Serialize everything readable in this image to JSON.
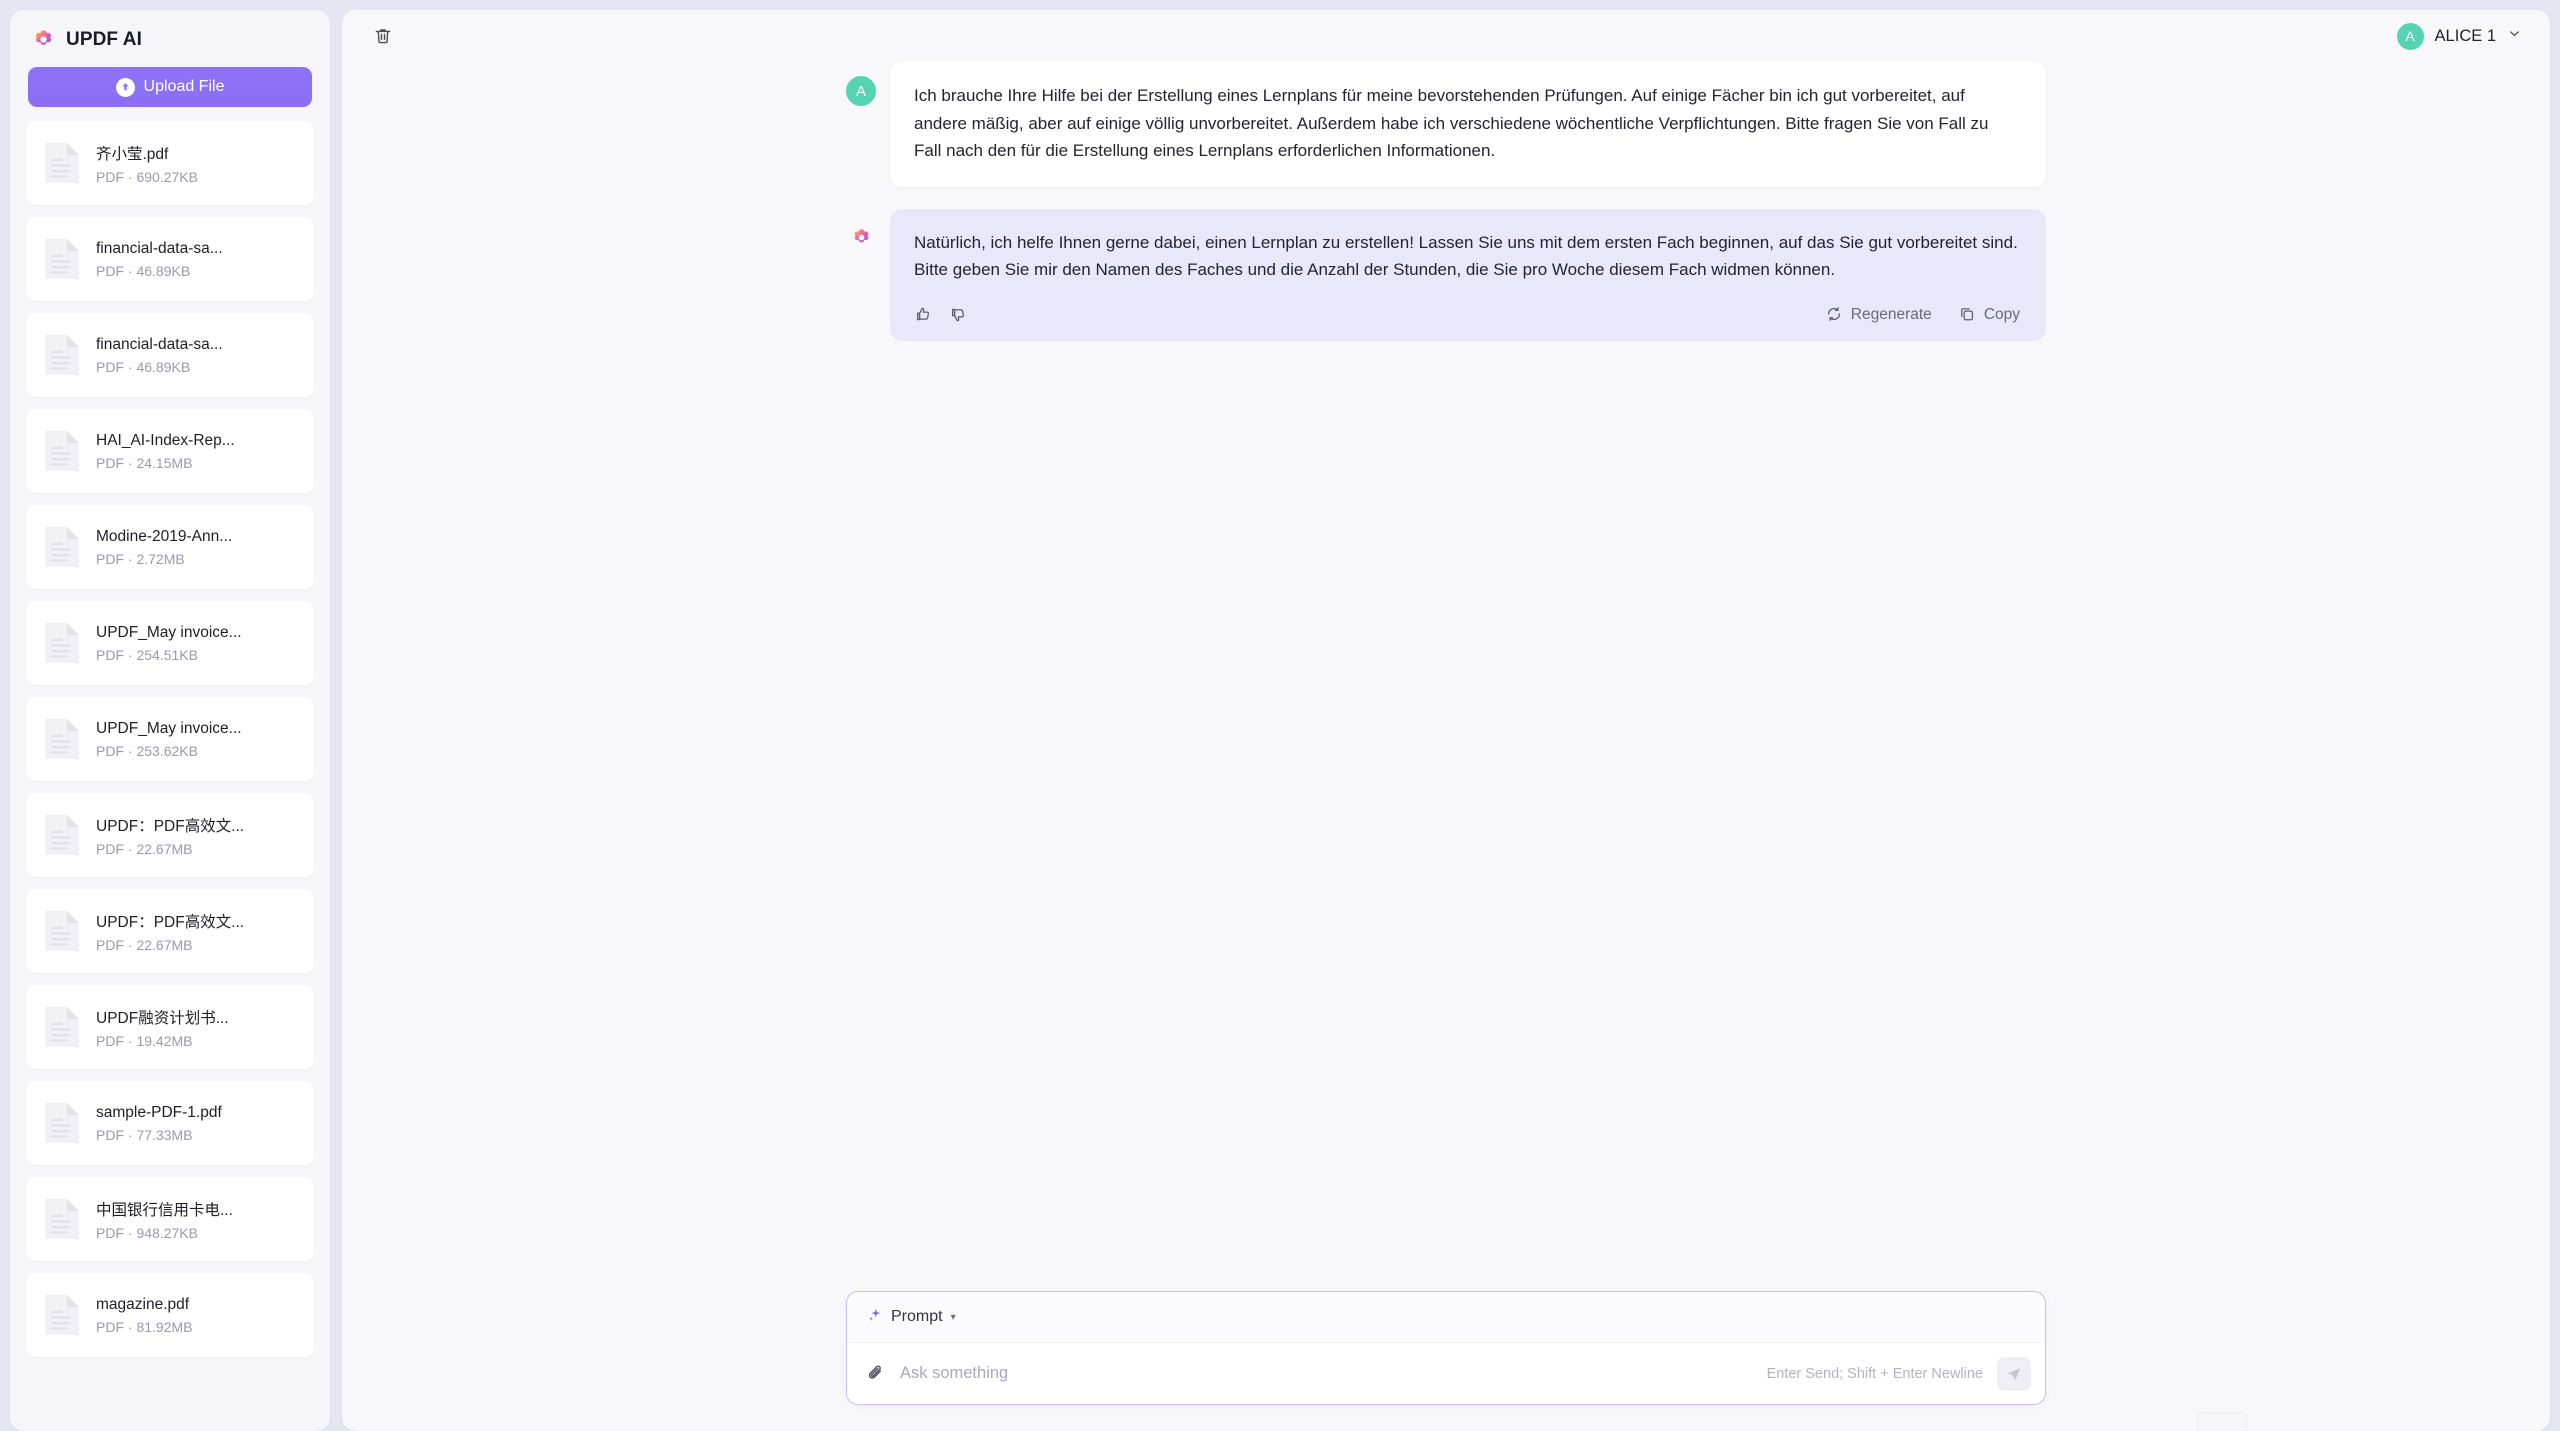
{
  "brand": {
    "title": "UPDF AI",
    "logo_icon": "updf-flower-logo"
  },
  "sidebar": {
    "upload_button": {
      "label": "Upload File",
      "icon": "upload-circle-icon"
    },
    "files": [
      {
        "name": "齐小莹.pdf",
        "meta": "PDF · 690.27KB"
      },
      {
        "name": "financial-data-sa...",
        "meta": "PDF · 46.89KB"
      },
      {
        "name": "financial-data-sa...",
        "meta": "PDF · 46.89KB"
      },
      {
        "name": "HAI_AI-Index-Rep...",
        "meta": "PDF · 24.15MB"
      },
      {
        "name": "Modine-2019-Ann...",
        "meta": "PDF · 2.72MB"
      },
      {
        "name": "UPDF_May invoice...",
        "meta": "PDF · 254.51KB"
      },
      {
        "name": "UPDF_May invoice...",
        "meta": "PDF · 253.62KB"
      },
      {
        "name": "UPDF：PDF高效文...",
        "meta": "PDF · 22.67MB"
      },
      {
        "name": "UPDF：PDF高效文...",
        "meta": "PDF · 22.67MB"
      },
      {
        "name": "UPDF融资计划书...",
        "meta": "PDF · 19.42MB"
      },
      {
        "name": "sample-PDF-1.pdf",
        "meta": "PDF · 77.33MB"
      },
      {
        "name": "中国银行信用卡电...",
        "meta": "PDF · 948.27KB"
      },
      {
        "name": "magazine.pdf",
        "meta": "PDF · 81.92MB"
      }
    ]
  },
  "topbar": {
    "delete_icon": "trash-icon",
    "user": {
      "initial": "A",
      "name": "ALICE 1",
      "caret_icon": "chevron-down-icon"
    }
  },
  "chat": {
    "user_message": {
      "avatar_initial": "A",
      "text": "Ich brauche Ihre Hilfe bei der Erstellung eines Lernplans für meine bevorstehenden Prüfungen. Auf einige Fächer bin ich gut vorbereitet, auf andere mäßig, aber auf einige völlig unvorbereitet. Außerdem habe ich verschiedene wöchentliche Verpflichtungen. Bitte fragen Sie von Fall zu Fall nach den für die Erstellung eines Lernplans erforderlichen Informationen."
    },
    "ai_message": {
      "avatar_icon": "updf-flower-logo",
      "text": "Natürlich, ich helfe Ihnen gerne dabei, einen Lernplan zu erstellen! Lassen Sie uns mit dem ersten Fach beginnen, auf das Sie gut vorbereitet sind. Bitte geben Sie mir den Namen des Faches und die Anzahl der Stunden, die Sie pro Woche diesem Fach widmen können.",
      "actions": {
        "like_icon": "thumbs-up-icon",
        "dislike_icon": "thumbs-down-icon",
        "regenerate_label": "Regenerate",
        "regenerate_icon": "refresh-icon",
        "copy_label": "Copy",
        "copy_icon": "copy-icon"
      }
    }
  },
  "composer": {
    "prompt_label": "Prompt",
    "prompt_icon": "sparkle-icon",
    "caret": "▾",
    "attach_icon": "paperclip-icon",
    "input_placeholder": "Ask something",
    "input_value": "",
    "hint": "Enter Send; Shift + Enter Newline",
    "send_icon": "send-plane-icon"
  },
  "colors": {
    "accent_purple": "#8a6ef5",
    "ai_bubble": "#e9e7fa",
    "avatar_teal": "#55d3b3",
    "page_bg": "#e6e6f3"
  }
}
